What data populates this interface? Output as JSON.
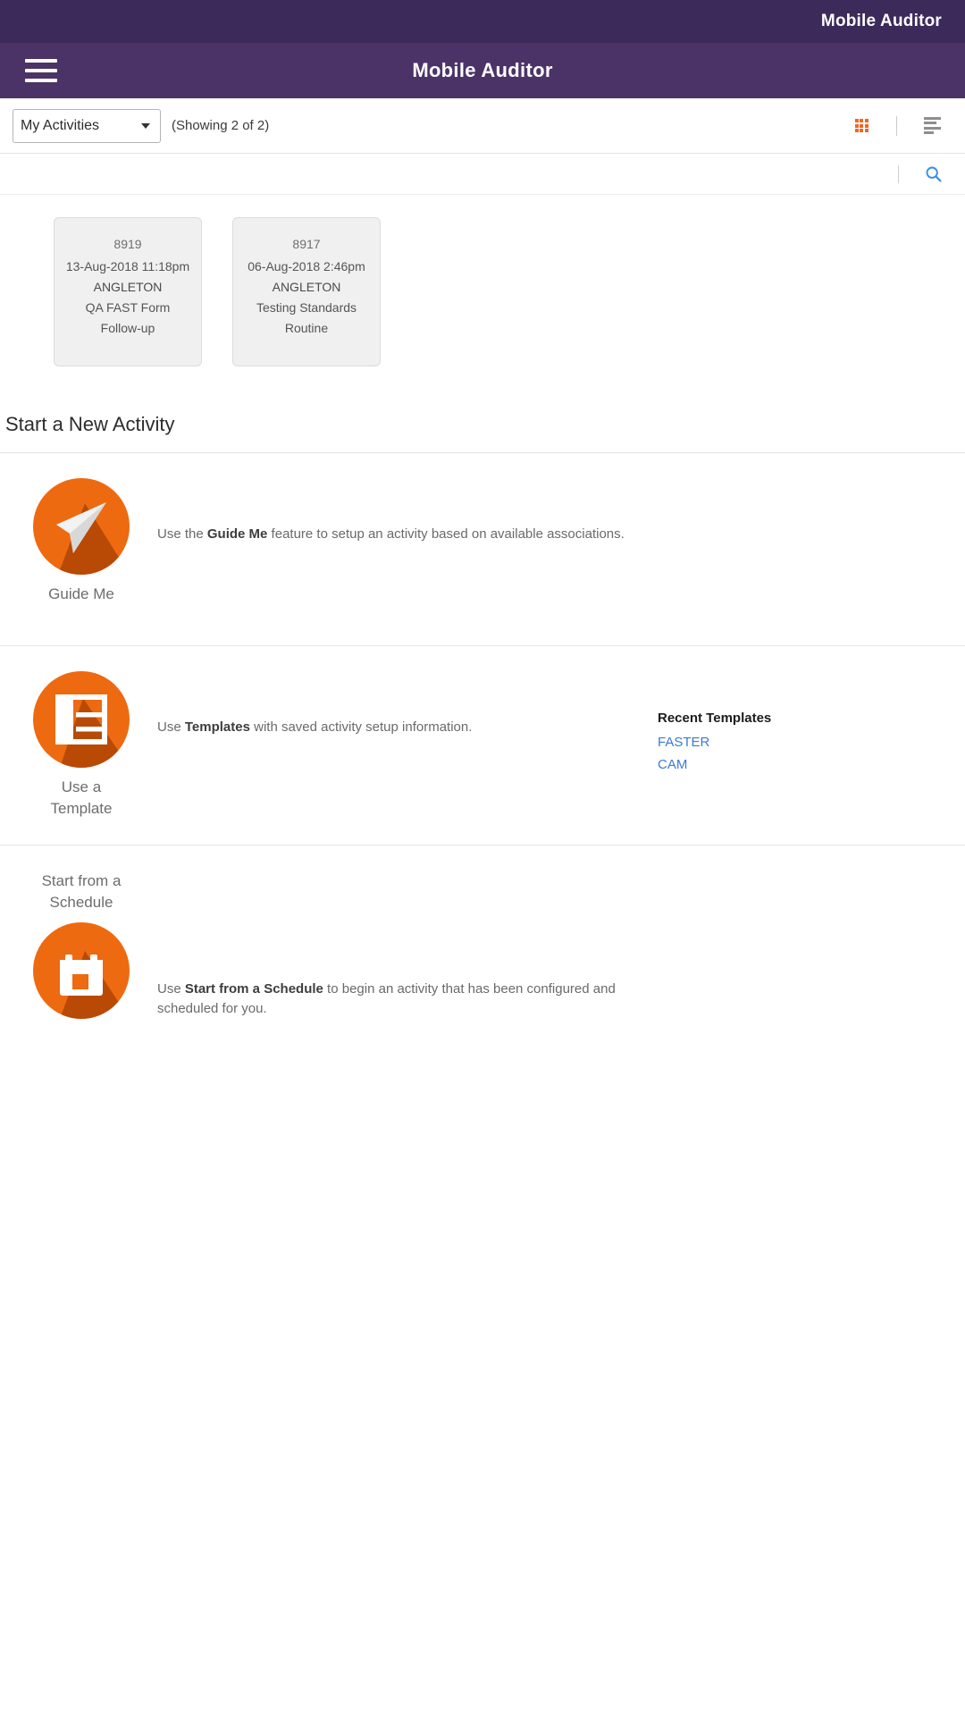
{
  "status_bar": {
    "title": "Mobile Auditor"
  },
  "app_bar": {
    "title": "Mobile Auditor",
    "menu_icon": "hamburger-menu-icon"
  },
  "toolbar": {
    "selected_filter": "My Activities",
    "filter_options": [
      "My Activities"
    ],
    "showing_text": "(Showing 2 of 2)",
    "tile_view_icon": "grid-view-icon",
    "list_view_icon": "list-view-icon",
    "search_icon": "search-icon",
    "accent_color": "#f26522",
    "link_color": "#3a7bd5",
    "brand_purple": "#4b3368"
  },
  "activities": [
    {
      "id": "8919",
      "datetime": "13-Aug-2018 11:18pm",
      "location": "ANGLETON",
      "form": "QA FAST Form",
      "type": "Follow-up"
    },
    {
      "id": "8917",
      "datetime": "06-Aug-2018 2:46pm",
      "location": "ANGLETON",
      "form": "Testing Standards",
      "type": "Routine"
    }
  ],
  "new_activity": {
    "heading": "Start a New Activity",
    "options": [
      {
        "label": "Guide Me",
        "icon": "paper-plane-icon",
        "desc_prefix": "Use the ",
        "desc_bold": "Guide Me",
        "desc_suffix": " feature to setup an activity based on available associations."
      },
      {
        "label": "Use a\nTemplate",
        "label_line1": "Use a",
        "label_line2": "Template",
        "icon": "template-layout-icon",
        "desc_prefix": "Use ",
        "desc_bold": "Templates",
        "desc_suffix": " with saved activity setup information.",
        "recent_title": "Recent Templates",
        "recent_items": [
          "FASTER",
          "CAM"
        ]
      },
      {
        "label_line1": "Start from a",
        "label_line2": "Schedule",
        "icon": "calendar-icon",
        "desc_prefix": "Use ",
        "desc_bold": "Start from a Schedule",
        "desc_suffix": " to begin an activity that has been configured and scheduled for you."
      }
    ]
  }
}
